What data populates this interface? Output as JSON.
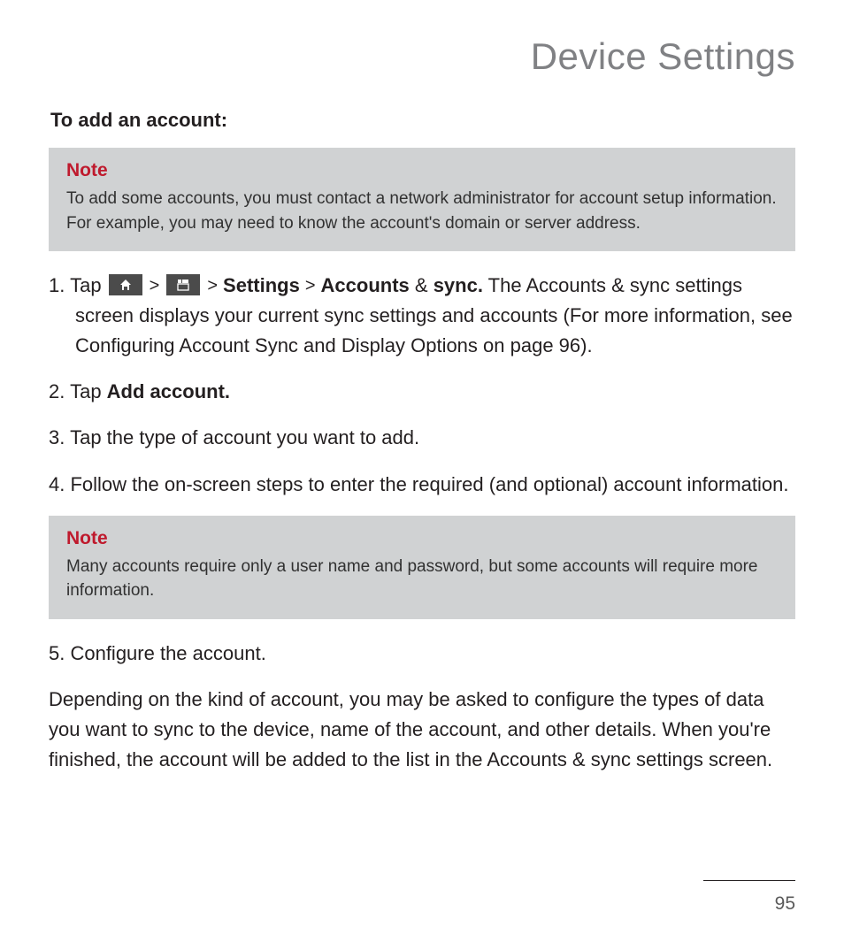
{
  "pageTitle": "Device Settings",
  "sectionHeading": "To add an account:",
  "note1": {
    "label": "Note",
    "body": "To add some accounts, you must contact a network administrator for account setup information. For example, you may need to know the account's domain or server address."
  },
  "sep": ">",
  "step1": {
    "pre": "Tap ",
    "afterIcons1": " ",
    "afterIcons2": " ",
    "settings": "Settings",
    "accounts": "Accounts",
    "amp": " & ",
    "sync": "sync.",
    "rest": " The Accounts & sync settings screen displays your current sync settings and accounts (For more information, see Configuring Account Sync and Display Options on page 96)."
  },
  "step2": {
    "pre": "Tap ",
    "bold": "Add account."
  },
  "step3": "Tap the type of account you want to add.",
  "step4": "Follow the on-screen steps to enter the required (and optional) account information.",
  "note2": {
    "label": "Note",
    "body": "Many accounts require only a user name and password, but some accounts will require more information."
  },
  "step5": "5. Configure the account.",
  "closingPara": "Depending on the kind of account, you may be asked to configure the types of data you want to sync to the device, name of the account, and other details. When you're finished, the account will be added to the list in the Accounts & sync settings screen.",
  "pageNumber": "95"
}
